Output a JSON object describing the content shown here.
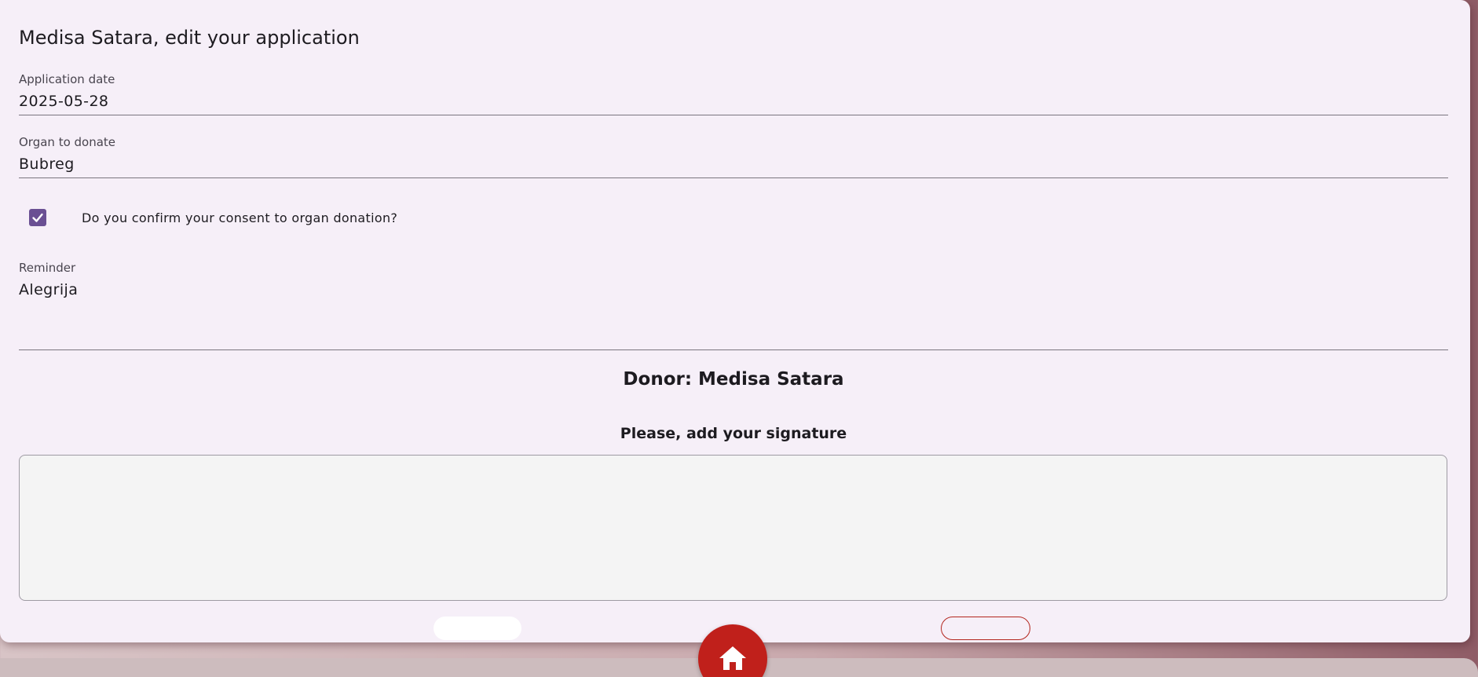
{
  "dialog": {
    "title": "Medisa Satara, edit your application"
  },
  "fields": {
    "application_date": {
      "label": "Application date",
      "value": "2025-05-28"
    },
    "organ": {
      "label": "Organ to donate",
      "value": "Bubreg"
    },
    "reminder": {
      "label": "Reminder",
      "value": "Alegrija"
    }
  },
  "consent": {
    "label": "Do you confirm your consent to organ donation?",
    "checked": true
  },
  "donor": {
    "text": "Donor: Medisa Satara"
  },
  "signature": {
    "label": "Please, add your signature"
  },
  "icons": {
    "check": "check-icon",
    "home": "home-icon"
  },
  "colors": {
    "accent": "#6a4f93",
    "danger": "#c0201b",
    "surface": "#f6eff8"
  }
}
